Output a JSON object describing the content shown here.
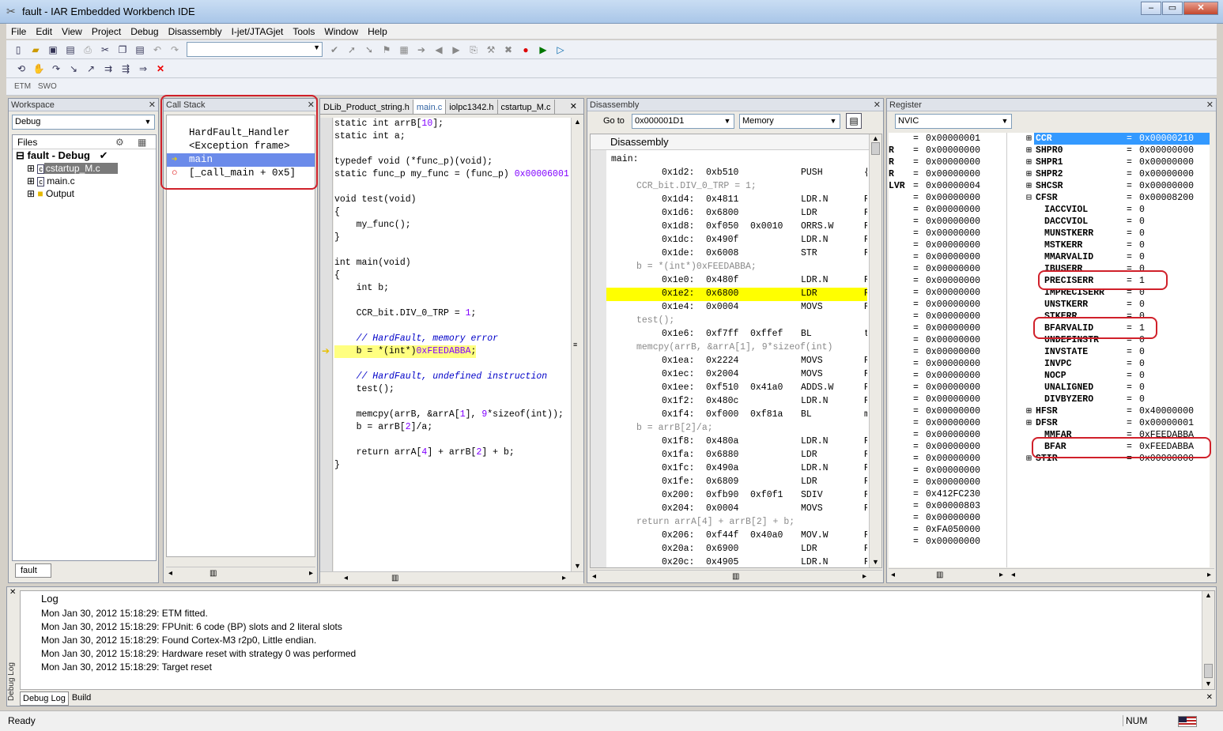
{
  "app": {
    "title": "fault - IAR Embedded Workbench IDE"
  },
  "menu": [
    "File",
    "Edit",
    "View",
    "Project",
    "Debug",
    "Disassembly",
    "I-jet/JTAGjet",
    "Tools",
    "Window",
    "Help"
  ],
  "toolbar3": {
    "etm": "ETM",
    "swo": "SWO"
  },
  "workspace": {
    "title": "Workspace",
    "config": "Debug",
    "files_label": "Files",
    "tree": [
      {
        "label": "fault - Debug",
        "check": "✔"
      },
      {
        "label": "cstartup_M.c"
      },
      {
        "label": "main.c"
      },
      {
        "label": "Output"
      }
    ],
    "tab": "fault"
  },
  "callstack": {
    "title": "Call Stack",
    "frames": [
      "HardFault_Handler",
      "<Exception frame>",
      "main",
      "[_call_main + 0x5]"
    ]
  },
  "editor": {
    "tabs": [
      "DLib_Product_string.h",
      "main.c",
      "iolpc1342.h",
      "cstartup_M.c"
    ],
    "lines": [
      [
        [
          "static int arrB[",
          ""
        ],
        [
          "10",
          "num"
        ],
        [
          "];",
          ""
        ]
      ],
      [
        [
          "static int a;",
          ""
        ]
      ],
      [
        [
          "",
          ""
        ]
      ],
      [
        [
          "typedef void (*func_p)(void);",
          ""
        ]
      ],
      [
        [
          "static func_p my_func = (func_p) ",
          ""
        ],
        [
          "0x00006001",
          "num"
        ]
      ],
      [
        [
          "",
          ""
        ]
      ],
      [
        [
          "void test(void)",
          ""
        ]
      ],
      [
        [
          "{",
          ""
        ]
      ],
      [
        [
          "    my_func();",
          ""
        ]
      ],
      [
        [
          "}",
          ""
        ]
      ],
      [
        [
          "",
          ""
        ]
      ],
      [
        [
          "int main(void)",
          ""
        ]
      ],
      [
        [
          "{",
          ""
        ]
      ],
      [
        [
          "    int b;",
          ""
        ]
      ],
      [
        [
          "",
          ""
        ]
      ],
      [
        [
          "    CCR_bit.DIV_0_TRP = ",
          ""
        ],
        [
          "1",
          "num"
        ],
        [
          ";",
          ""
        ]
      ],
      [
        [
          "",
          ""
        ]
      ],
      [
        [
          "    // HardFault, memory error",
          "cmt"
        ]
      ],
      [
        [
          "    b = *(int*)",
          ""
        ],
        [
          "0xFEEDABBA",
          "num"
        ],
        [
          ";",
          ""
        ]
      ],
      [
        [
          "",
          ""
        ]
      ],
      [
        [
          "    // HardFault, undefined instruction",
          "cmt"
        ]
      ],
      [
        [
          "    test();",
          ""
        ]
      ],
      [
        [
          "",
          ""
        ]
      ],
      [
        [
          "    memcpy(arrB, &arrA[",
          ""
        ],
        [
          "1",
          "num"
        ],
        [
          "], ",
          ""
        ],
        [
          "9",
          "num"
        ],
        [
          "*sizeof(int));",
          ""
        ]
      ],
      [
        [
          "    b = arrB[",
          ""
        ],
        [
          "2",
          "num"
        ],
        [
          "]/a;",
          ""
        ]
      ],
      [
        [
          "",
          ""
        ]
      ],
      [
        [
          "    return arrA[",
          ""
        ],
        [
          "4",
          "num"
        ],
        [
          "] + arrB[",
          ""
        ],
        [
          "2",
          "num"
        ],
        [
          "] + b;",
          ""
        ]
      ],
      [
        [
          "}",
          ""
        ]
      ]
    ]
  },
  "disasm": {
    "title": "Disassembly",
    "goto_label": "Go to",
    "goto_value": "0x000001D1",
    "memory_label": "Memory",
    "header": "Disassembly",
    "rows": [
      {
        "t": "label",
        "text": "main:"
      },
      {
        "t": "ins",
        "addr": "0x1d2:",
        "code": "0xb510",
        "code2": "",
        "op": "PUSH",
        "arg": "{"
      },
      {
        "t": "src",
        "text": "CCR_bit.DIV_0_TRP = 1;"
      },
      {
        "t": "ins",
        "addr": "0x1d4:",
        "code": "0x4811",
        "code2": "",
        "op": "LDR.N",
        "arg": "R"
      },
      {
        "t": "ins",
        "addr": "0x1d6:",
        "code": "0x6800",
        "code2": "",
        "op": "LDR",
        "arg": "R"
      },
      {
        "t": "ins",
        "addr": "0x1d8:",
        "code": "0xf050",
        "code2": "0x0010",
        "op": "ORRS.W",
        "arg": "R"
      },
      {
        "t": "ins",
        "addr": "0x1dc:",
        "code": "0x490f",
        "code2": "",
        "op": "LDR.N",
        "arg": "R"
      },
      {
        "t": "ins",
        "addr": "0x1de:",
        "code": "0x6008",
        "code2": "",
        "op": "STR",
        "arg": "R"
      },
      {
        "t": "src",
        "text": "b = *(int*)0xFEEDABBA;"
      },
      {
        "t": "ins",
        "addr": "0x1e0:",
        "code": "0x480f",
        "code2": "",
        "op": "LDR.N",
        "arg": "R"
      },
      {
        "t": "cur",
        "addr": "0x1e2:",
        "code": "0x6800",
        "code2": "",
        "op": "LDR",
        "arg": "R"
      },
      {
        "t": "ins",
        "addr": "0x1e4:",
        "code": "0x0004",
        "code2": "",
        "op": "MOVS",
        "arg": "R"
      },
      {
        "t": "src",
        "text": "test();"
      },
      {
        "t": "ins",
        "addr": "0x1e6:",
        "code": "0xf7ff",
        "code2": "0xffef",
        "op": "BL",
        "arg": "t"
      },
      {
        "t": "src",
        "text": "memcpy(arrB, &arrA[1], 9*sizeof(int)"
      },
      {
        "t": "ins",
        "addr": "0x1ea:",
        "code": "0x2224",
        "code2": "",
        "op": "MOVS",
        "arg": "R"
      },
      {
        "t": "ins",
        "addr": "0x1ec:",
        "code": "0x2004",
        "code2": "",
        "op": "MOVS",
        "arg": "R"
      },
      {
        "t": "ins",
        "addr": "0x1ee:",
        "code": "0xf510",
        "code2": "0x41a0",
        "op": "ADDS.W",
        "arg": "R"
      },
      {
        "t": "ins",
        "addr": "0x1f2:",
        "code": "0x480c",
        "code2": "",
        "op": "LDR.N",
        "arg": "R"
      },
      {
        "t": "ins",
        "addr": "0x1f4:",
        "code": "0xf000",
        "code2": "0xf81a",
        "op": "BL",
        "arg": "m"
      },
      {
        "t": "src",
        "text": "b = arrB[2]/a;"
      },
      {
        "t": "ins",
        "addr": "0x1f8:",
        "code": "0x480a",
        "code2": "",
        "op": "LDR.N",
        "arg": "R"
      },
      {
        "t": "ins",
        "addr": "0x1fa:",
        "code": "0x6880",
        "code2": "",
        "op": "LDR",
        "arg": "R"
      },
      {
        "t": "ins",
        "addr": "0x1fc:",
        "code": "0x490a",
        "code2": "",
        "op": "LDR.N",
        "arg": "R"
      },
      {
        "t": "ins",
        "addr": "0x1fe:",
        "code": "0x6809",
        "code2": "",
        "op": "LDR",
        "arg": "R"
      },
      {
        "t": "ins",
        "addr": "0x200:",
        "code": "0xfb90",
        "code2": "0xf0f1",
        "op": "SDIV",
        "arg": "R"
      },
      {
        "t": "ins",
        "addr": "0x204:",
        "code": "0x0004",
        "code2": "",
        "op": "MOVS",
        "arg": "R"
      },
      {
        "t": "src",
        "text": "return arrA[4] + arrB[2] + b;"
      },
      {
        "t": "ins",
        "addr": "0x206:",
        "code": "0xf44f",
        "code2": "0x40a0",
        "op": "MOV.W",
        "arg": "R"
      },
      {
        "t": "ins",
        "addr": "0x20a:",
        "code": "0x6900",
        "code2": "",
        "op": "LDR",
        "arg": "R"
      },
      {
        "t": "ins",
        "addr": "0x20c:",
        "code": "0x4905",
        "code2": "",
        "op": "LDR.N",
        "arg": "R"
      }
    ]
  },
  "register": {
    "title": "Register",
    "group": "NVIC",
    "left": [
      {
        "n": "",
        "v": "0x00000001"
      },
      {
        "n": "R",
        "v": "0x00000000"
      },
      {
        "n": "R",
        "v": "0x00000000"
      },
      {
        "n": "R",
        "v": "0x00000000"
      },
      {
        "n": "LVR",
        "v": "0x00000004"
      },
      {
        "n": "",
        "v": "0x00000000"
      },
      {
        "n": "",
        "v": "0x00000000"
      },
      {
        "n": "",
        "v": "0x00000000"
      },
      {
        "n": "",
        "v": "0x00000000"
      },
      {
        "n": "",
        "v": "0x00000000"
      },
      {
        "n": "",
        "v": "0x00000000"
      },
      {
        "n": "",
        "v": "0x00000000"
      },
      {
        "n": "",
        "v": "0x00000000"
      },
      {
        "n": "",
        "v": "0x00000000"
      },
      {
        "n": "",
        "v": "0x00000000"
      },
      {
        "n": "",
        "v": "0x00000000"
      },
      {
        "n": "",
        "v": "0x00000000"
      },
      {
        "n": "",
        "v": "0x00000000"
      },
      {
        "n": "",
        "v": "0x00000000"
      },
      {
        "n": "",
        "v": "0x00000000"
      },
      {
        "n": "",
        "v": "0x00000000"
      },
      {
        "n": "",
        "v": "0x00000000"
      },
      {
        "n": "",
        "v": "0x00000000"
      },
      {
        "n": "",
        "v": "0x00000000"
      },
      {
        "n": "",
        "v": "0x00000000"
      },
      {
        "n": "",
        "v": "0x00000000"
      },
      {
        "n": "",
        "v": "0x00000000"
      },
      {
        "n": "",
        "v": "0x00000000"
      },
      {
        "n": "",
        "v": "0x00000000"
      },
      {
        "n": "",
        "v": "0x00000000"
      },
      {
        "n": "",
        "v": "0x412FC230"
      },
      {
        "n": "",
        "v": "0x00000803"
      },
      {
        "n": "",
        "v": "0x00000000"
      },
      {
        "n": "",
        "v": "0xFA050000"
      },
      {
        "n": "",
        "v": "0x00000000"
      }
    ],
    "right": [
      {
        "e": "⊞",
        "n": "CCR",
        "v": "0x00000210",
        "sel": true
      },
      {
        "e": "⊞",
        "n": "SHPR0",
        "v": "0x00000000"
      },
      {
        "e": "⊞",
        "n": "SHPR1",
        "v": "0x00000000"
      },
      {
        "e": "⊞",
        "n": "SHPR2",
        "v": "0x00000000"
      },
      {
        "e": "⊞",
        "n": "SHCSR",
        "v": "0x00000000"
      },
      {
        "e": "⊟",
        "n": "CFSR",
        "v": "0x00008200"
      },
      {
        "e": "",
        "n": "IACCVIOL",
        "v": "0"
      },
      {
        "e": "",
        "n": "DACCVIOL",
        "v": "0"
      },
      {
        "e": "",
        "n": "MUNSTKERR",
        "v": "0"
      },
      {
        "e": "",
        "n": "MSTKERR",
        "v": "0"
      },
      {
        "e": "",
        "n": "MMARVALID",
        "v": "0"
      },
      {
        "e": "",
        "n": "IBUSERR",
        "v": "0"
      },
      {
        "e": "",
        "n": "PRECISERR",
        "v": "1"
      },
      {
        "e": "",
        "n": "IMPRECISERR",
        "v": "0"
      },
      {
        "e": "",
        "n": "UNSTKERR",
        "v": "0"
      },
      {
        "e": "",
        "n": "STKERR",
        "v": "0"
      },
      {
        "e": "",
        "n": "BFARVALID",
        "v": "1"
      },
      {
        "e": "",
        "n": "UNDEFINSTR",
        "v": "0"
      },
      {
        "e": "",
        "n": "INVSTATE",
        "v": "0"
      },
      {
        "e": "",
        "n": "INVPC",
        "v": "0"
      },
      {
        "e": "",
        "n": "NOCP",
        "v": "0"
      },
      {
        "e": "",
        "n": "UNALIGNED",
        "v": "0"
      },
      {
        "e": "",
        "n": "DIVBYZERO",
        "v": "0"
      },
      {
        "e": "⊞",
        "n": "HFSR",
        "v": "0x40000000"
      },
      {
        "e": "⊞",
        "n": "DFSR",
        "v": "0x00000001"
      },
      {
        "e": "",
        "n": "MMFAR",
        "v": "0xFEEDABBA"
      },
      {
        "e": "",
        "n": "BFAR",
        "v": "0xFEEDABBA"
      },
      {
        "e": "⊞",
        "n": "STIR",
        "v": "0x00000000"
      }
    ]
  },
  "log": {
    "header": "Log",
    "lines": [
      "Mon Jan 30, 2012 15:18:29: ETM fitted.",
      "Mon Jan 30, 2012 15:18:29:  FPUnit: 6 code (BP) slots and 2 literal slots",
      "Mon Jan 30, 2012 15:18:29: Found Cortex-M3 r2p0, Little endian.",
      "Mon Jan 30, 2012 15:18:29: Hardware reset with strategy 0 was performed",
      "Mon Jan 30, 2012 15:18:29: Target reset"
    ],
    "side_label": "Debug Log",
    "tabs": [
      "Debug Log",
      "Build"
    ]
  },
  "status": {
    "text": "Ready",
    "num": "NUM"
  }
}
